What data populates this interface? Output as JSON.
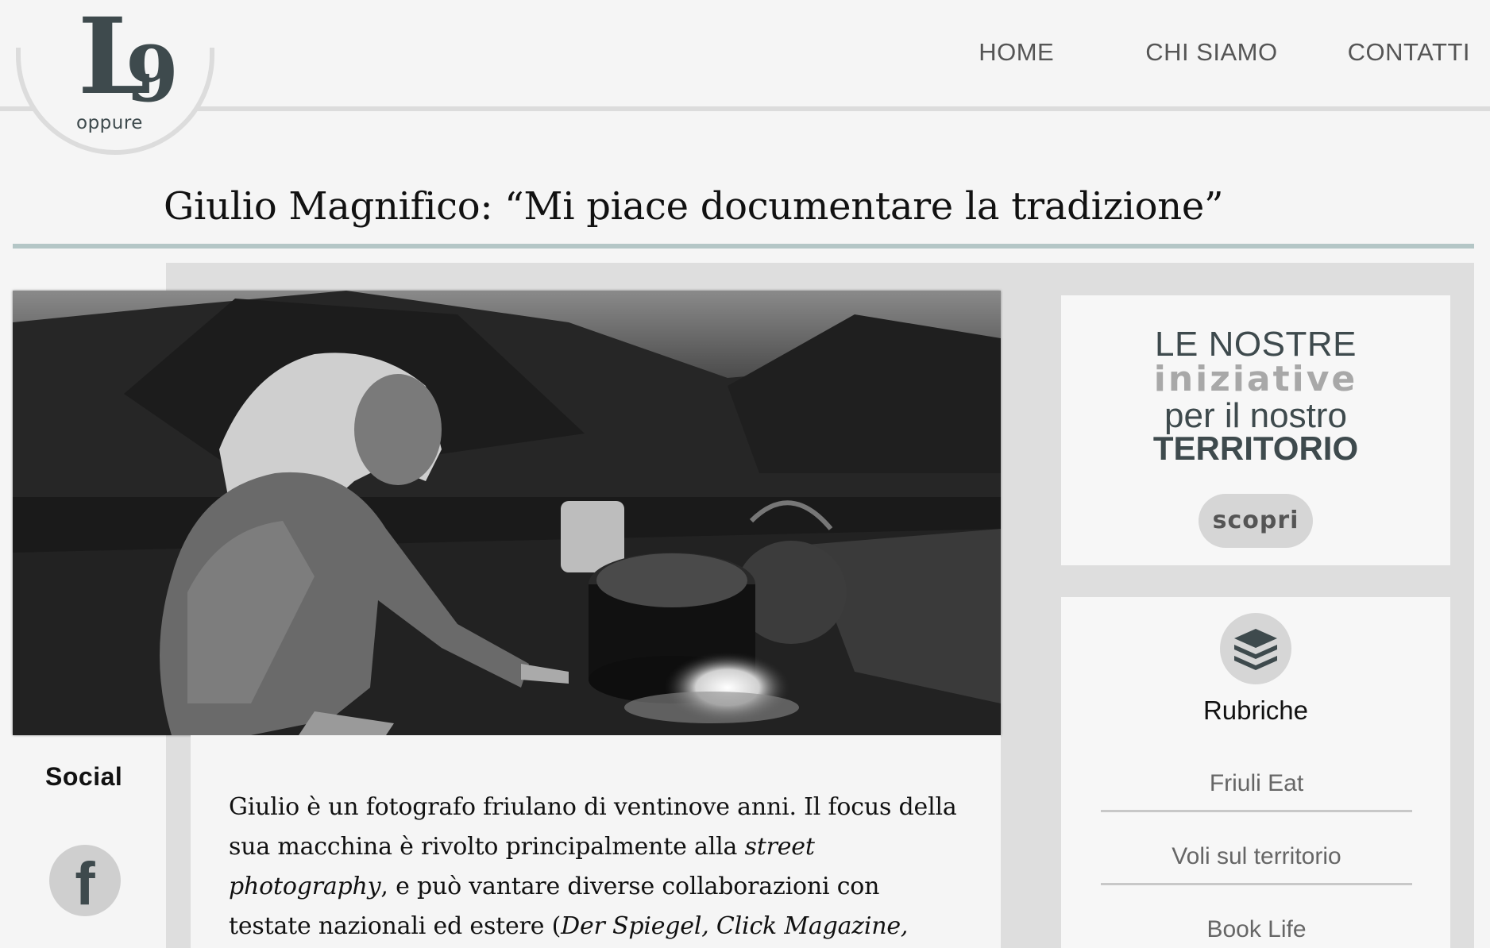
{
  "header": {
    "logo_letter": "L",
    "logo_mark": "9",
    "logo_text": "oppure",
    "nav": [
      {
        "label": "HOME"
      },
      {
        "label": "CHI SIAMO"
      },
      {
        "label": "CONTATTI"
      }
    ]
  },
  "article": {
    "title": "Giulio Magnifico: “Mi piace documentare la tradizione”",
    "body_1": "Giulio è un fotografo friulano di ventinove anni. Il focus della sua macchina è rivolto principalmente alla ",
    "body_em_1": "street photography",
    "body_2": ", e può vantare diverse collaborazioni con testate nazionali ed estere (",
    "body_em_2": "Der Spiegel, Click Magazine, Independent, Messaggero Veneto,"
  },
  "social": {
    "label": "Social",
    "facebook_glyph": "f"
  },
  "sidebar": {
    "promo": {
      "line1": "LE NOSTRE",
      "line2": "iniziative",
      "line3": "per il nostro",
      "line4": "TERRITORIO",
      "button": "scopri"
    },
    "rubriche": {
      "title": "Rubriche",
      "items": [
        "Friuli Eat",
        "Voli sul territorio",
        "Book Life"
      ]
    }
  },
  "colors": {
    "logo": "#3e4a4d",
    "title_rule": "#b4c6c6",
    "panel_gray": "#dedede",
    "pill": "#d6d6d6"
  },
  "icons": [
    "facebook-icon",
    "stack-layers-icon"
  ]
}
